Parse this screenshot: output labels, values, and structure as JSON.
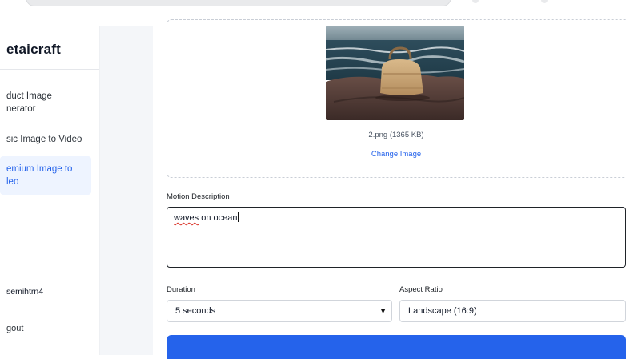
{
  "sidebar": {
    "brand": "etaicraft",
    "items": [
      {
        "label_line1": "duct Image",
        "label_line2": "nerator"
      },
      {
        "label_line1": "sic Image to Video",
        "label_line2": ""
      },
      {
        "label_line1": "emium Image to",
        "label_line2": "leo"
      }
    ],
    "user": "semihtrn4",
    "logout": "gout"
  },
  "upload": {
    "file_name": "2.png (1365 KB)",
    "change_label": "Change Image"
  },
  "motion": {
    "label": "Motion Description",
    "word1": "waves",
    "rest": " on ocean"
  },
  "duration": {
    "label": "Duration",
    "value": "5 seconds"
  },
  "aspect": {
    "label": "Aspect Ratio",
    "value": "Landscape (16:9)"
  },
  "colors": {
    "accent": "#2563eb",
    "active_bg": "#eef4ff",
    "gutter": "#f4f6f9"
  }
}
